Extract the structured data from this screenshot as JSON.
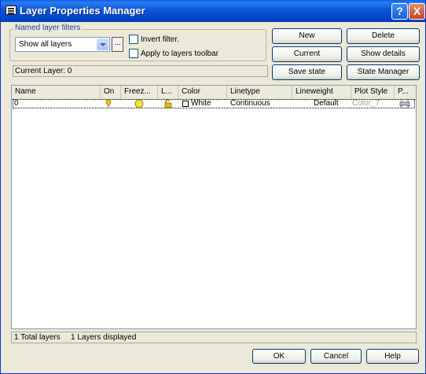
{
  "window": {
    "title": "Layer Properties Manager",
    "help_label": "?",
    "close_label": "X"
  },
  "filters": {
    "group_label": "Named layer filters",
    "selected": "Show all layers",
    "dots_label": "...",
    "invert_label": "Invert filter.",
    "apply_label": "Apply to layers toolbar"
  },
  "buttons": {
    "new": "New",
    "delete": "Delete",
    "current": "Current",
    "show_details": "Show details",
    "save_state": "Save state",
    "state_manager": "State Manager",
    "ok": "OK",
    "cancel": "Cancel",
    "help": "Help"
  },
  "current_layer": "Current Layer:  0",
  "table": {
    "headers": {
      "name": "Name",
      "on": "On",
      "freeze": "Freez...",
      "lock": "L...",
      "color": "Color",
      "linetype": "Linetype",
      "lineweight": "Lineweight",
      "plot_style": "Plot Style",
      "plot": "P..."
    },
    "rows": [
      {
        "name": "0",
        "color": "White",
        "linetype": "Continuous",
        "lineweight": "Default",
        "plot_style": "Color_7"
      }
    ]
  },
  "status": {
    "total": "1 Total layers",
    "displayed": "1 Layers displayed"
  },
  "colors": {
    "title_bar": "#0054e3",
    "dialog_bg": "#ece9d8",
    "on_bulb": "#e7c500",
    "freeze_sun": "#f2e23a",
    "disabled_text": "#a0a0a0"
  }
}
